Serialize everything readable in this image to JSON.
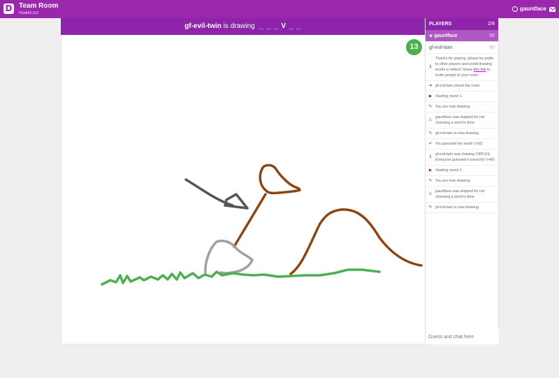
{
  "app": {
    "logo_letter": "D",
    "room_title": "Team Room",
    "round": "Round 2/3",
    "username": "gauntface"
  },
  "game": {
    "drawer": "gf-evil-twin",
    "is_drawing_text": "is drawing",
    "word_hint": "_ _ _ V _ _",
    "timer": "13"
  },
  "players": {
    "title": "PLAYERS",
    "count": "2/8",
    "list": [
      {
        "name": "gauntface",
        "score": "50",
        "me": true
      },
      {
        "name": "gf-evil-twin",
        "score": "40",
        "me": false
      }
    ]
  },
  "chat": {
    "messages": [
      {
        "icon": "info-icon",
        "glyph": "ℹ",
        "text": "Thanks for playing, please be polite to other players and avoid drawing words or letters! Share",
        "link": "this link",
        "text_after": "to invite people to your room."
      },
      {
        "icon": "enter-icon",
        "glyph": "➜",
        "text": "gf-evil-twin joined the room."
      },
      {
        "icon": "play-icon",
        "glyph": "▶",
        "text": "Starting round 1."
      },
      {
        "icon": "pencil-icon",
        "glyph": "✎",
        "text": "You are now drawing."
      },
      {
        "icon": "warning-icon",
        "glyph": "⚠",
        "text": "gauntface was skipped for not choosing a word in time."
      },
      {
        "icon": "pencil-icon",
        "glyph": "✎",
        "text": "gf-evil-twin is now drawing."
      },
      {
        "icon": "check-icon",
        "glyph": "✔",
        "text": "You guessed the word! (+50)"
      },
      {
        "icon": "info-icon",
        "glyph": "ℹ",
        "text": "gf-evil-twin was drawing CIRCUS. Everyone guessed it correctly! (+40)"
      },
      {
        "icon": "play-icon",
        "glyph": "▶",
        "text": "Starting round 2."
      },
      {
        "icon": "pencil-icon",
        "glyph": "✎",
        "text": "You are now drawing."
      },
      {
        "icon": "warning-icon",
        "glyph": "⚠",
        "text": "gauntface was skipped for not choosing a word in time."
      },
      {
        "icon": "pencil-icon",
        "glyph": "✎",
        "text": "gf-evil-twin is now drawing."
      }
    ],
    "input_placeholder": "Guess and chat here"
  },
  "colors": {
    "brand": "#9b27af",
    "timer": "#4caf50",
    "brown": "#8b4513",
    "green": "#4caf50",
    "gray": "#9e9e9e",
    "dark_gray": "#555555"
  }
}
